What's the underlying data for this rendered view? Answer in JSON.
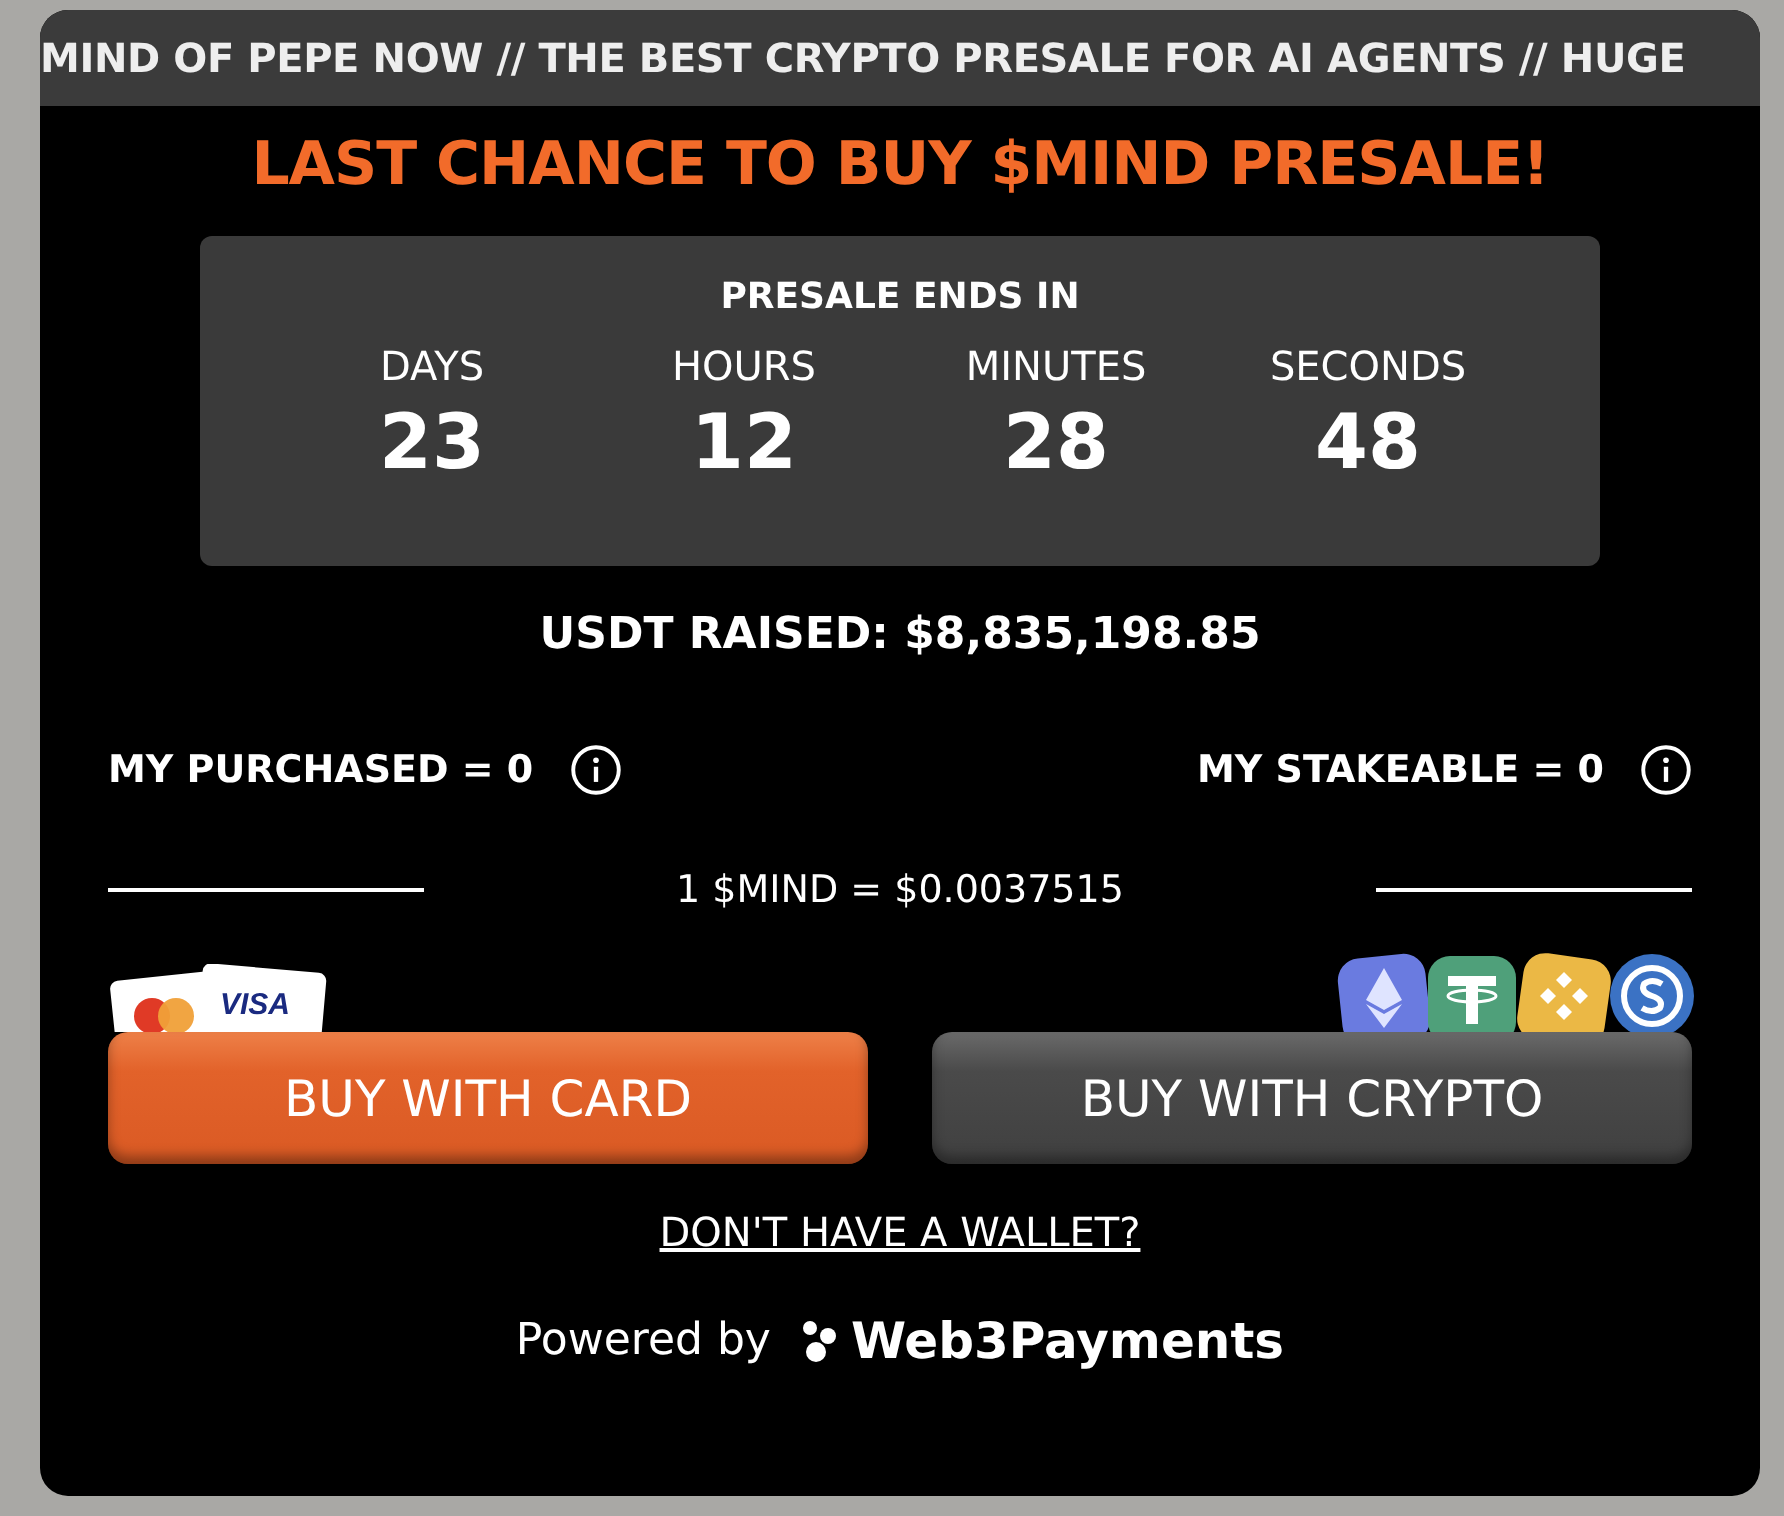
{
  "ticker": "MIND OF PEPE NOW // THE BEST CRYPTO PRESALE FOR AI AGENTS // HUGE",
  "headline": "LAST CHANCE TO BUY $MIND PRESALE!",
  "countdown": {
    "title": "PRESALE ENDS IN",
    "units": [
      {
        "label": "DAYS",
        "value": "23"
      },
      {
        "label": "HOURS",
        "value": "12"
      },
      {
        "label": "MINUTES",
        "value": "28"
      },
      {
        "label": "SECONDS",
        "value": "48"
      }
    ]
  },
  "raised": "USDT RAISED: $8,835,198.85",
  "balances": [
    {
      "label": "MY PURCHASED = 0"
    },
    {
      "label": "MY STAKEABLE = 0"
    }
  ],
  "price": "1 $MIND = $0.0037515",
  "card_brand": "VISA",
  "buttons": [
    {
      "label": "BUY WITH CARD",
      "kind": "card"
    },
    {
      "label": "BUY WITH CRYPTO",
      "kind": "crypto"
    }
  ],
  "wallet_link": "DON'T HAVE A WALLET?",
  "powered_by": {
    "prefix": "Powered by",
    "brand": "Web3Payments"
  }
}
